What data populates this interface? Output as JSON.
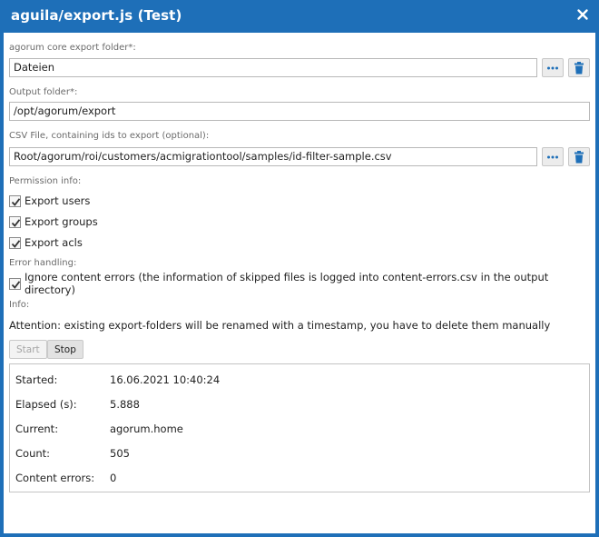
{
  "window": {
    "title": "aguila/export.js (Test)",
    "accent_color": "#1e6fb8",
    "close_icon": "close-icon"
  },
  "form": {
    "core_folder": {
      "label": "agorum core export folder*:",
      "value": "Dateien",
      "browse_icon": "ellipsis-icon",
      "delete_icon": "trash-icon"
    },
    "output_folder": {
      "label": "Output folder*:",
      "value": "/opt/agorum/export"
    },
    "csv_file": {
      "label": "CSV File, containing ids to export (optional):",
      "value": "Root/agorum/roi/customers/acmigrationtool/samples/id-filter-sample.csv",
      "browse_icon": "ellipsis-icon",
      "delete_icon": "trash-icon"
    },
    "permission_info": {
      "label": "Permission info:",
      "options": [
        {
          "label": "Export users",
          "checked": true
        },
        {
          "label": "Export groups",
          "checked": true
        },
        {
          "label": "Export acls",
          "checked": true
        }
      ]
    },
    "error_handling": {
      "label": "Error handling:",
      "option": {
        "label": "Ignore content errors (the information of skipped files is logged into content-errors.csv in the output directory)",
        "checked": true
      }
    },
    "info": {
      "label": "Info:",
      "text": "Attention: existing export-folders will be renamed with a timestamp, you have to delete them manually"
    }
  },
  "actions": {
    "start_label": "Start",
    "start_enabled": false,
    "stop_label": "Stop"
  },
  "status": {
    "rows": [
      {
        "key": "Started:",
        "value": "16.06.2021 10:40:24"
      },
      {
        "key": "Elapsed (s):",
        "value": "5.888"
      },
      {
        "key": "Current:",
        "value": "agorum.home"
      },
      {
        "key": "Count:",
        "value": "505"
      },
      {
        "key": "Content errors:",
        "value": "0"
      }
    ]
  }
}
